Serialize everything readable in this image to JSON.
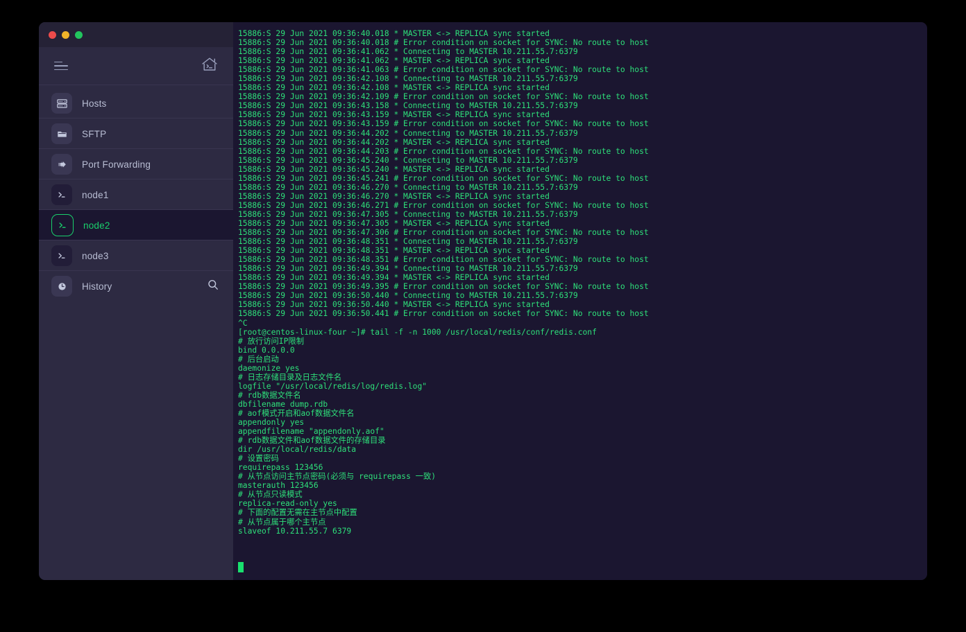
{
  "window": {
    "controls": [
      {
        "name": "close",
        "color": "#ec4b4b"
      },
      {
        "name": "minimize",
        "color": "#f0b429"
      },
      {
        "name": "maximize",
        "color": "#22c55e"
      }
    ],
    "accent_green": "#19d06c",
    "sidebar_bg": "#2d2a42",
    "terminal_bg": "#1b1630",
    "terminal_fg": "#2ee07a"
  },
  "sidebar": {
    "menu_icon": "hamburger-icon",
    "home_icon": "home-terminal-icon",
    "search_icon": "search-icon",
    "items": [
      {
        "label": "Hosts",
        "icon": "server-rack-icon",
        "active": false
      },
      {
        "label": "SFTP",
        "icon": "folder-icon",
        "active": false
      },
      {
        "label": "Port Forwarding",
        "icon": "forward-arrow-icon",
        "active": false
      },
      {
        "label": "node1",
        "icon": "terminal-icon",
        "active": false
      },
      {
        "label": "node2",
        "icon": "terminal-icon",
        "active": true
      },
      {
        "label": "node3",
        "icon": "terminal-icon",
        "active": false
      },
      {
        "label": "History",
        "icon": "clock-icon",
        "active": false
      }
    ]
  },
  "terminal": {
    "cursor_visible": true,
    "lines": [
      "15886:S 29 Jun 2021 09:36:40.018 * MASTER <-> REPLICA sync started",
      "15886:S 29 Jun 2021 09:36:40.018 # Error condition on socket for SYNC: No route to host",
      "15886:S 29 Jun 2021 09:36:41.062 * Connecting to MASTER 10.211.55.7:6379",
      "15886:S 29 Jun 2021 09:36:41.062 * MASTER <-> REPLICA sync started",
      "15886:S 29 Jun 2021 09:36:41.063 # Error condition on socket for SYNC: No route to host",
      "15886:S 29 Jun 2021 09:36:42.108 * Connecting to MASTER 10.211.55.7:6379",
      "15886:S 29 Jun 2021 09:36:42.108 * MASTER <-> REPLICA sync started",
      "15886:S 29 Jun 2021 09:36:42.109 # Error condition on socket for SYNC: No route to host",
      "15886:S 29 Jun 2021 09:36:43.158 * Connecting to MASTER 10.211.55.7:6379",
      "15886:S 29 Jun 2021 09:36:43.159 * MASTER <-> REPLICA sync started",
      "15886:S 29 Jun 2021 09:36:43.159 # Error condition on socket for SYNC: No route to host",
      "15886:S 29 Jun 2021 09:36:44.202 * Connecting to MASTER 10.211.55.7:6379",
      "15886:S 29 Jun 2021 09:36:44.202 * MASTER <-> REPLICA sync started",
      "15886:S 29 Jun 2021 09:36:44.203 # Error condition on socket for SYNC: No route to host",
      "15886:S 29 Jun 2021 09:36:45.240 * Connecting to MASTER 10.211.55.7:6379",
      "15886:S 29 Jun 2021 09:36:45.240 * MASTER <-> REPLICA sync started",
      "15886:S 29 Jun 2021 09:36:45.241 # Error condition on socket for SYNC: No route to host",
      "15886:S 29 Jun 2021 09:36:46.270 * Connecting to MASTER 10.211.55.7:6379",
      "15886:S 29 Jun 2021 09:36:46.270 * MASTER <-> REPLICA sync started",
      "15886:S 29 Jun 2021 09:36:46.271 # Error condition on socket for SYNC: No route to host",
      "15886:S 29 Jun 2021 09:36:47.305 * Connecting to MASTER 10.211.55.7:6379",
      "15886:S 29 Jun 2021 09:36:47.305 * MASTER <-> REPLICA sync started",
      "15886:S 29 Jun 2021 09:36:47.306 # Error condition on socket for SYNC: No route to host",
      "15886:S 29 Jun 2021 09:36:48.351 * Connecting to MASTER 10.211.55.7:6379",
      "15886:S 29 Jun 2021 09:36:48.351 * MASTER <-> REPLICA sync started",
      "15886:S 29 Jun 2021 09:36:48.351 # Error condition on socket for SYNC: No route to host",
      "15886:S 29 Jun 2021 09:36:49.394 * Connecting to MASTER 10.211.55.7:6379",
      "15886:S 29 Jun 2021 09:36:49.394 * MASTER <-> REPLICA sync started",
      "15886:S 29 Jun 2021 09:36:49.395 # Error condition on socket for SYNC: No route to host",
      "15886:S 29 Jun 2021 09:36:50.440 * Connecting to MASTER 10.211.55.7:6379",
      "15886:S 29 Jun 2021 09:36:50.440 * MASTER <-> REPLICA sync started",
      "15886:S 29 Jun 2021 09:36:50.441 # Error condition on socket for SYNC: No route to host",
      "^C",
      "[root@centos-linux-four ~]# tail -f -n 1000 /usr/local/redis/conf/redis.conf",
      "# 放行访问IP限制",
      "bind 0.0.0.0",
      "# 后台启动",
      "daemonize yes",
      "# 日志存储目录及日志文件名",
      "logfile \"/usr/local/redis/log/redis.log\"",
      "# rdb数据文件名",
      "dbfilename dump.rdb",
      "# aof模式开启和aof数据文件名",
      "appendonly yes",
      "appendfilename \"appendonly.aof\"",
      "# rdb数据文件和aof数据文件的存储目录",
      "dir /usr/local/redis/data",
      "# 设置密码",
      "requirepass 123456",
      "# 从节点访问主节点密码(必须与 requirepass 一致)",
      "masterauth 123456",
      "# 从节点只读模式",
      "replica-read-only yes",
      "# 下面的配置无需在主节点中配置",
      "# 从节点属于哪个主节点",
      "slaveof 10.211.55.7 6379"
    ]
  }
}
